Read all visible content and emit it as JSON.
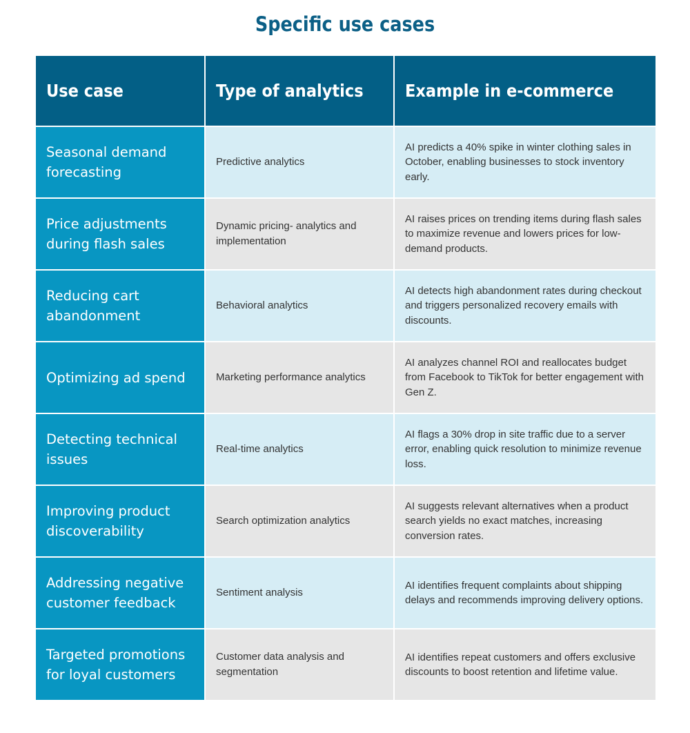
{
  "title": "Specific use cases",
  "table": {
    "headers": [
      "Use case",
      "Type of analytics",
      "Example in e-commerce"
    ],
    "rows": [
      {
        "use_case": "Seasonal demand forecasting",
        "type": "Predictive analytics",
        "example": "AI predicts a 40% spike in winter clothing sales in October, enabling businesses to stock inventory early."
      },
      {
        "use_case": "Price adjustments during flash sales",
        "type": "Dynamic pricing- analytics and implementation",
        "example": "AI raises prices on trending items during flash sales to maximize revenue and lowers prices for low-demand products."
      },
      {
        "use_case": "Reducing cart abandonment",
        "type": "Behavioral analytics",
        "example": "AI detects high abandonment rates during checkout and triggers personalized recovery emails with discounts."
      },
      {
        "use_case": "Optimizing ad spend",
        "type": "Marketing performance analytics",
        "example": "AI analyzes channel ROI and reallocates budget from Facebook to TikTok for better engagement with Gen Z."
      },
      {
        "use_case": "Detecting technical issues",
        "type": "Real-time analytics",
        "example": "AI flags a 30% drop in site traffic due to a server error, enabling quick resolution to minimize revenue loss."
      },
      {
        "use_case": "Improving product discoverability",
        "type": "Search optimization analytics",
        "example": "AI suggests relevant alternatives when a product search yields no exact matches, increasing conversion rates."
      },
      {
        "use_case": "Addressing negative customer feedback",
        "type": "Sentiment analysis",
        "example": "AI identifies frequent complaints about shipping delays and recommends improving delivery options."
      },
      {
        "use_case": "Targeted promotions for loyal customers",
        "type": "Customer data analysis and segmentation",
        "example": "AI identifies repeat customers and offers exclusive discounts to boost retention and lifetime value."
      }
    ]
  },
  "colors": {
    "title": "#0b5f86",
    "header_bg": "#035f86",
    "usecase_bg": "#0896c2",
    "row_light_blue": "#d6edf5",
    "row_gray": "#e6e6e6",
    "body_text": "#333333"
  }
}
